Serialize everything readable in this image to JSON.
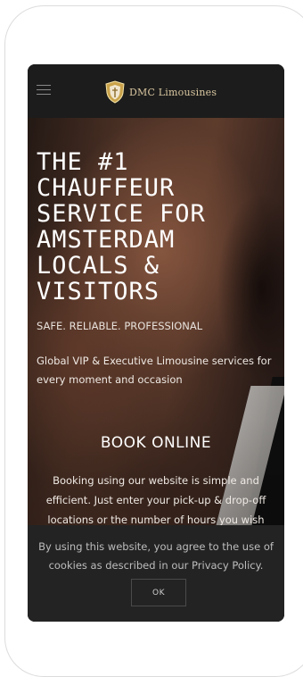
{
  "header": {
    "brand": "DMC Limousines",
    "menu_icon": "hamburger-menu-icon",
    "logo_icon": "shield-crest-logo",
    "accent_color": "#d9c7a0"
  },
  "hero": {
    "headline": "THE #1\nCHAUFFEUR\nSERVICE FOR\nAMSTERDAM\nLOCALS &\nVISITORS",
    "tagline": "SAFE. RELIABLE. PROFESSIONAL",
    "subtitle": "Global VIP & Executive Limousine services for every moment and occasion",
    "book_title": "BOOK ONLINE",
    "book_text": "Booking using our website is simple and efficient. Just enter your pick-up & drop-off locations or the number of hours you wish"
  },
  "cookie_banner": {
    "text": "By using this website, you agree to the use of cookies as described in our Privacy Policy.",
    "ok_label": "OK"
  }
}
